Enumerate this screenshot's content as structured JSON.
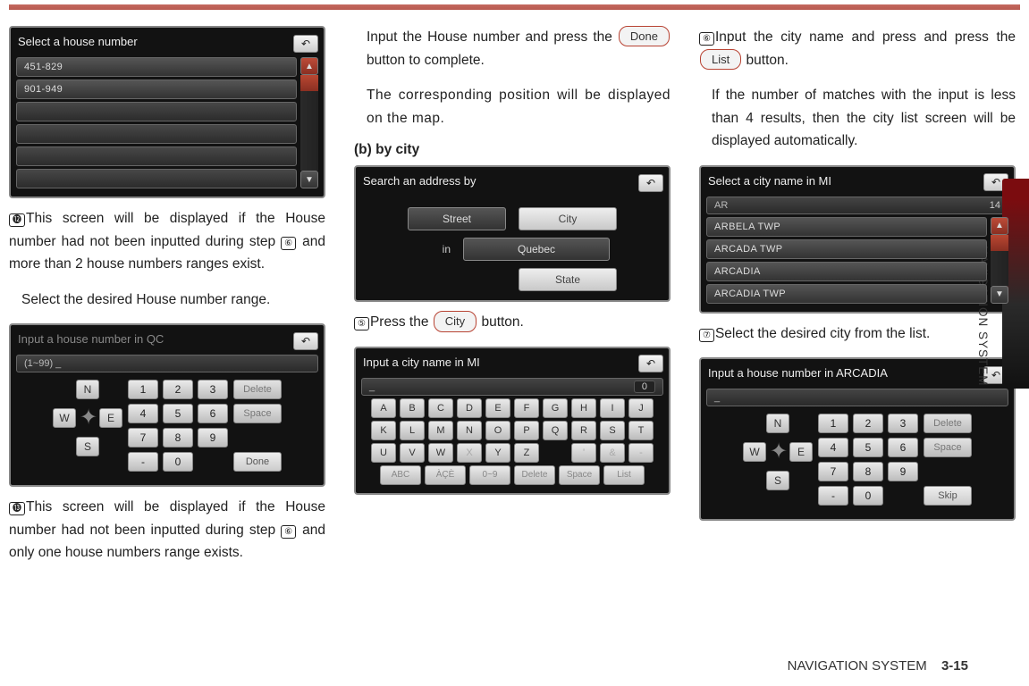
{
  "side_label": "NAVIGATION SYSTEM",
  "footer": {
    "section": "NAVIGATION SYSTEM",
    "page": "3-15"
  },
  "col1": {
    "shot1": {
      "title": "Select a house number",
      "rows": [
        "451-829",
        "901-949"
      ]
    },
    "step12_mark": "⓬",
    "step12_a": "This screen will be displayed if the House number had not been inputted during step ",
    "step12_refmark": "⑥",
    "step12_b": " and more than 2 house numbers ranges exist.",
    "step12_c": "Select the desired House number range.",
    "shot2": {
      "title": "Input a house number in QC",
      "input": "(1~99) _",
      "dir": {
        "N": "N",
        "W": "W",
        "E": "E",
        "S": "S"
      },
      "nums": [
        "1",
        "2",
        "3",
        "4",
        "5",
        "6",
        "7",
        "8",
        "9",
        "-",
        "0",
        ""
      ],
      "side": [
        "Delete",
        "Space",
        "",
        "Done"
      ]
    },
    "step13_mark": "⓭",
    "step13_a": "This screen will be displayed if the House number had not been inputted during step ",
    "step13_refmark": "⑥",
    "step13_b": " and only one house numbers range exists."
  },
  "col2": {
    "top_a": "Input the House number and press the ",
    "done_label": "Done",
    "top_b": " button to complete.",
    "top_c": "The corresponding position will be displayed on the map.",
    "subhead": "(b) by city",
    "shot_search": {
      "title": "Search an address by",
      "street": "Street",
      "city": "City",
      "in": "in",
      "place": "Quebec",
      "state": "State"
    },
    "step5_mark": "⑤",
    "step5_a": "Press the ",
    "city_label": "City",
    "step5_b": " button.",
    "shot_qwerty": {
      "title": "Input a city name in MI",
      "input": "_",
      "count": "0",
      "rows": [
        [
          "A",
          "B",
          "C",
          "D",
          "E",
          "F",
          "G",
          "H",
          "I",
          "J"
        ],
        [
          "K",
          "L",
          "M",
          "N",
          "O",
          "P",
          "Q",
          "R",
          "S",
          "T"
        ],
        [
          "U",
          "V",
          "W",
          "X",
          "Y",
          "Z",
          "",
          "'",
          "&",
          "-"
        ]
      ],
      "dim": [
        "X",
        "'",
        "&",
        "-"
      ],
      "bottom": [
        "ABC",
        "ÀÇÈ",
        "0~9",
        "Delete",
        "Space",
        "List"
      ]
    }
  },
  "col3": {
    "step6_mark": "⑥",
    "step6_a": "Input the city name and press and press the ",
    "list_label": "List",
    "step6_b": " button.",
    "step6_c": "If the number of matches with the input is less than 4 results, then the city list screen will be displayed automatically.",
    "shot_list": {
      "title": "Select a city name in MI",
      "input": "AR",
      "count": "14",
      "rows": [
        "ARBELA TWP",
        "ARCADA TWP",
        "ARCADIA",
        "ARCADIA TWP"
      ]
    },
    "step7_mark": "⑦",
    "step7_a": "Select the desired city from the list.",
    "shot_num": {
      "title": "Input a house number in ARCADIA",
      "input": "_",
      "dir": {
        "N": "N",
        "W": "W",
        "E": "E",
        "S": "S"
      },
      "nums": [
        "1",
        "2",
        "3",
        "4",
        "5",
        "6",
        "7",
        "8",
        "9",
        "-",
        "0",
        ""
      ],
      "side": [
        "Delete",
        "Space",
        "",
        "Skip"
      ]
    }
  }
}
